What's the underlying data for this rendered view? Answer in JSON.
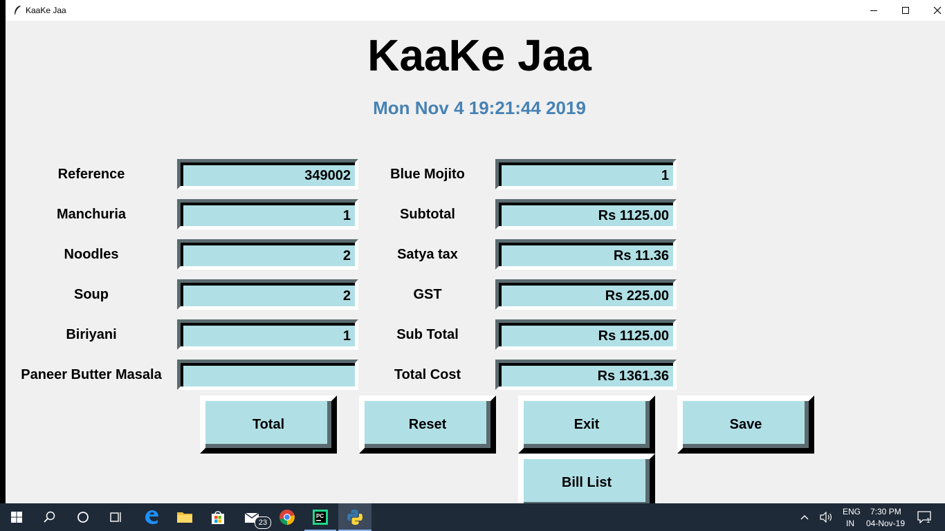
{
  "window": {
    "title": "KaaKe Jaa"
  },
  "heading": "KaaKe Jaa",
  "clock": "Mon Nov  4 19:21:44 2019",
  "left_fields": [
    {
      "label": "Reference",
      "value": "349002"
    },
    {
      "label": "Manchuria",
      "value": "1"
    },
    {
      "label": "Noodles",
      "value": "2"
    },
    {
      "label": "Soup",
      "value": "2"
    },
    {
      "label": "Biriyani",
      "value": "1"
    },
    {
      "label": "Paneer Butter Masala",
      "value": ""
    }
  ],
  "right_fields": [
    {
      "label": "Blue Mojito",
      "value": "1"
    },
    {
      "label": "Subtotal",
      "value": "Rs 1125.00"
    },
    {
      "label": "Satya tax",
      "value": "Rs 11.36"
    },
    {
      "label": "GST",
      "value": "Rs 225.00"
    },
    {
      "label": "Sub Total",
      "value": "Rs 1125.00"
    },
    {
      "label": "Total Cost",
      "value": "Rs 1361.36"
    }
  ],
  "buttons": {
    "total": "Total",
    "reset": "Reset",
    "exit": "Exit",
    "save": "Save",
    "bill_list": "Bill List"
  },
  "taskbar": {
    "mail_badge": "23",
    "lang_top": "ENG",
    "lang_bottom": "IN",
    "time": "7:30 PM",
    "date": "04-Nov-19",
    "notifications": "1"
  },
  "colors": {
    "entry_bg": "#b0e0e6",
    "clock": "#4682b4",
    "taskbar": "#1f2a38"
  }
}
